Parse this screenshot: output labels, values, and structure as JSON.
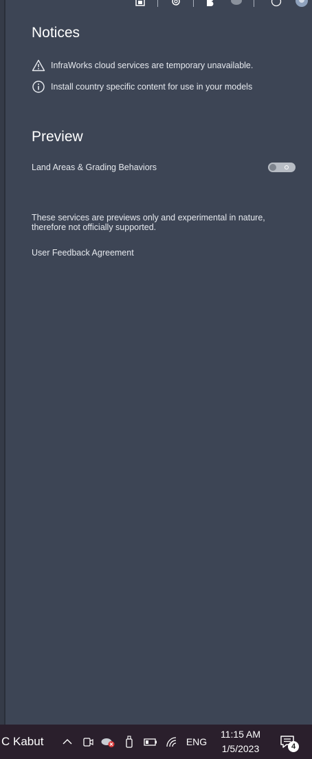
{
  "notices": {
    "title": "Notices",
    "items": [
      {
        "icon": "warning-icon",
        "text": "InfraWorks cloud services are temporary unavailable."
      },
      {
        "icon": "info-icon",
        "text": "Install country specific content for use in your models"
      }
    ]
  },
  "preview": {
    "title": "Preview",
    "features": [
      {
        "label": "Land Areas & Grading Behaviors",
        "enabled": false
      }
    ],
    "disclaimer": "These services are previews only and experimental in nature, therefore not officially supported.",
    "feedback_link": "User Feedback Agreement"
  },
  "taskbar": {
    "weather": "C  Kabut",
    "language": "ENG",
    "time": "11:15 AM",
    "date": "1/5/2023",
    "notifications": "4"
  },
  "colors": {
    "panel_bg": "#3d4555",
    "taskbar_bg": "#2a1f2c",
    "toggle_off": "#b7bcc4"
  }
}
